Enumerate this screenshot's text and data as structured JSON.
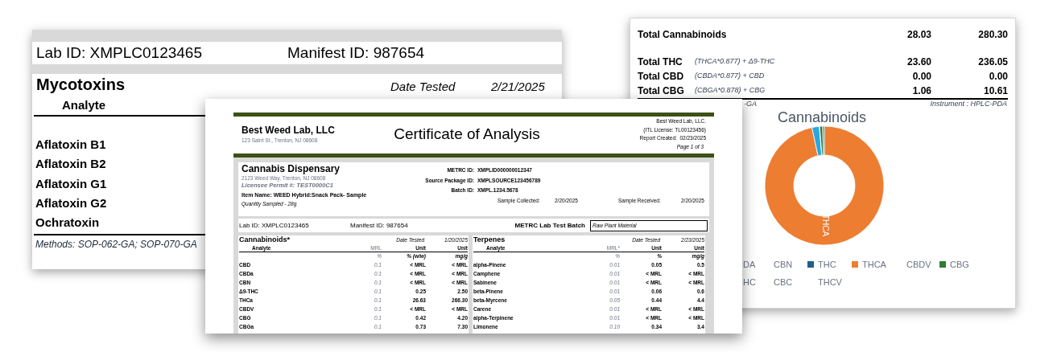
{
  "mycotoxins_report": {
    "lab_id": "Lab ID: XMPLC0123465",
    "manifest_id": "Manifest ID: 987654",
    "title": "Mycotoxins",
    "date_tested_label": "Date Tested",
    "date_tested": "2/21/2025",
    "column_header": "Analyte",
    "analytes": [
      "Aflatoxin B1",
      "Aflatoxin B2",
      "Aflatoxin G1",
      "Aflatoxin G2",
      "Ochratoxin"
    ],
    "methods": "Methods: SOP-062-GA; SOP-070-GA"
  },
  "totals_report": {
    "rows": [
      {
        "label": "Total Cannabinoids",
        "value_1": "28.03",
        "value_2": "280.30"
      },
      {
        "label": "Total THC",
        "formula": "(THCA*0.877) + Δ9-THC",
        "value_1": "23.60",
        "value_2": "236.05"
      },
      {
        "label": "Total CBD",
        "formula": "(CBDA*0.877) + CBD",
        "value_1": "0.00",
        "value_2": "0.00"
      },
      {
        "label": "Total CBG",
        "formula": "(CBGA*0.878) + CBG",
        "value_1": "1.06",
        "value_2": "10.61"
      }
    ],
    "method_fragment": "-GA",
    "instrument": "Instrument : HPLC-PDA",
    "chart_title": "Cannabinoids",
    "slice_label": "THCA",
    "legend": [
      {
        "label": "DA"
      },
      {
        "label": "CBN"
      },
      {
        "label": "THC",
        "color": "#1f5f8b"
      },
      {
        "label": "THCA",
        "color": "#ed7d31"
      },
      {
        "label": "CBDV"
      },
      {
        "label": "CBG",
        "color": "#2e7d32"
      },
      {
        "label": "HC"
      },
      {
        "label": "CBC"
      },
      {
        "label": "THCV"
      }
    ]
  },
  "certificate": {
    "lab_name": "Best Weed Lab, LLC",
    "lab_address": "123 Saint St., Trenton, NJ 08608",
    "title": "Certificate of Analysis",
    "lab_info": [
      "Best Weed Lab, LLC.",
      "(ITL License: TL00123456)",
      "Report Created:  02/23/2025"
    ],
    "page": "Page 1 of 3",
    "client": {
      "name": "Cannabis Dispensary",
      "address": "2123 Weed Way, Trenton, NJ 08608",
      "permit": "Licensee Permit #: TEST0000C1",
      "item_name": "Item Name: WEED Hybrid:Snack Pack- Sample",
      "quantity": "Quantity Sampled - 28g"
    },
    "ids": [
      {
        "label": "METRC ID:",
        "value": "XMPLID000000012347"
      },
      {
        "label": "Source Package ID:",
        "value": "XMPLSOURCE123456789"
      },
      {
        "label": "Batch ID:",
        "value": "XMPL.1234.5678"
      }
    ],
    "sample_collected": {
      "label": "Sample Collected:",
      "value": "2/20/2025"
    },
    "sample_received": {
      "label": "Sample Received:",
      "value": "2/20/2025"
    },
    "lab_id": "Lab ID: XMPLC0123465",
    "manifest_id": "Manifest ID: 987654",
    "batch_label": "METRC Lab Test Batch",
    "batch_value": "Raw Plant Material",
    "panels": [
      {
        "title": "Cannabinoids*",
        "date_tested_label": "Date Tested",
        "date_tested": "1/20/2025",
        "headers": [
          "Analyte",
          "MRL",
          "Unit",
          "Unit"
        ],
        "units": [
          "%",
          "% (w/w)",
          "mg/g"
        ],
        "rows": [
          {
            "analyte": "CBD",
            "mrl": "0.1",
            "percent": "< MRL",
            "mg_per_g": "< MRL"
          },
          {
            "analyte": "CBDa",
            "mrl": "0.1",
            "percent": "< MRL",
            "mg_per_g": "< MRL"
          },
          {
            "analyte": "CBN",
            "mrl": "0.1",
            "percent": "< MRL",
            "mg_per_g": "< MRL"
          },
          {
            "analyte": "Δ9-THC",
            "mrl": "0.1",
            "percent": "0.25",
            "mg_per_g": "2.50"
          },
          {
            "analyte": "THCa",
            "mrl": "0.1",
            "percent": "26.63",
            "mg_per_g": "266.30"
          },
          {
            "analyte": "CBDV",
            "mrl": "0.1",
            "percent": "< MRL",
            "mg_per_g": "< MRL"
          },
          {
            "analyte": "CBG",
            "mrl": "0.1",
            "percent": "0.42",
            "mg_per_g": "4.20"
          },
          {
            "analyte": "CBGa",
            "mrl": "0.1",
            "percent": "0.73",
            "mg_per_g": "7.30"
          }
        ]
      },
      {
        "title": "Terpenes",
        "date_tested_label": "Date Tested",
        "date_tested": "2/23/2025",
        "headers": [
          "Analyte",
          "MRL*",
          "Unit",
          "Unit"
        ],
        "units": [
          "%",
          "%",
          "mg/g"
        ],
        "rows": [
          {
            "analyte": "alpha-Pinene",
            "mrl": "0.01",
            "percent": "0.05",
            "mg_per_g": "0.5"
          },
          {
            "analyte": "Camphene",
            "mrl": "0.01",
            "percent": "< MRL",
            "mg_per_g": "< MRL"
          },
          {
            "analyte": "Sabinene",
            "mrl": "0.01",
            "percent": "< MRL",
            "mg_per_g": "< MRL"
          },
          {
            "analyte": "beta-Pinene",
            "mrl": "0.01",
            "percent": "0.06",
            "mg_per_g": "0.6"
          },
          {
            "analyte": "beta-Myrcene",
            "mrl": "0.05",
            "percent": "0.44",
            "mg_per_g": "4.4"
          },
          {
            "analyte": "Carene",
            "mrl": "0.01",
            "percent": "< MRL",
            "mg_per_g": "< MRL"
          },
          {
            "analyte": "alpha-Terpinene",
            "mrl": "0.01",
            "percent": "< MRL",
            "mg_per_g": "< MRL"
          },
          {
            "analyte": "Limonene",
            "mrl": "0.10",
            "percent": "0.34",
            "mg_per_g": "3.4"
          }
        ]
      }
    ]
  }
}
